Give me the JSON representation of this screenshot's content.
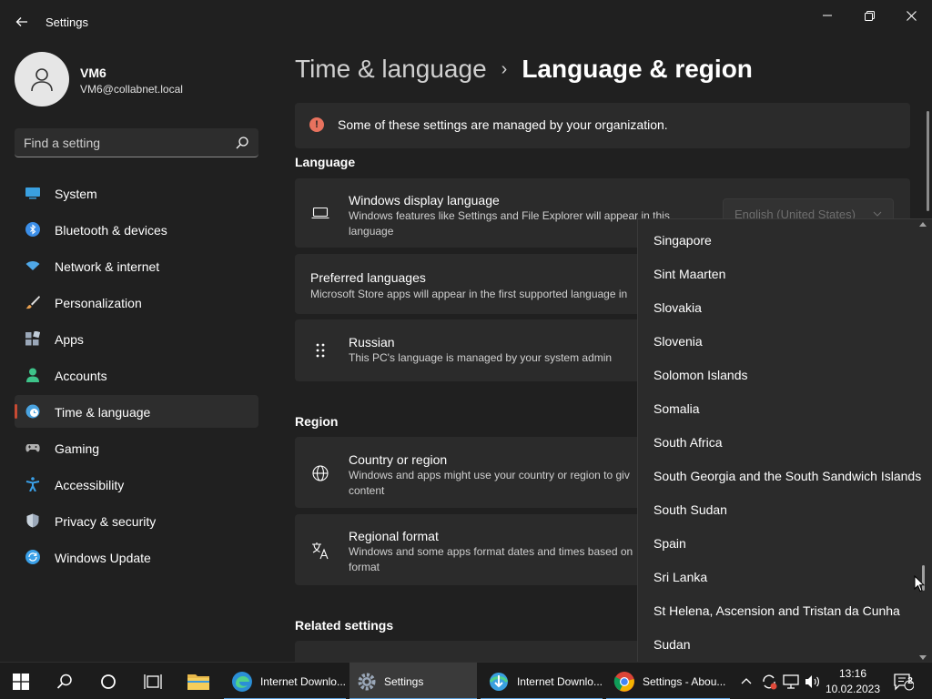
{
  "window": {
    "title": "Settings"
  },
  "user": {
    "name": "VM6",
    "email": "VM6@collabnet.local"
  },
  "search": {
    "placeholder": "Find a setting"
  },
  "sidebar": {
    "items": [
      {
        "label": "System",
        "icon": "system-icon",
        "color": "#3aa0e0"
      },
      {
        "label": "Bluetooth & devices",
        "icon": "bluetooth-icon",
        "color": "#3b8ee8"
      },
      {
        "label": "Network & internet",
        "icon": "wifi-icon",
        "color": "#4fa8e8"
      },
      {
        "label": "Personalization",
        "icon": "brush-icon",
        "color": "#e8a050"
      },
      {
        "label": "Apps",
        "icon": "apps-icon",
        "color": "#9aa7b8"
      },
      {
        "label": "Accounts",
        "icon": "person-icon",
        "color": "#3ec48a"
      },
      {
        "label": "Time & language",
        "icon": "clock-globe-icon",
        "color": "#4aa3e0",
        "active": true
      },
      {
        "label": "Gaming",
        "icon": "controller-icon",
        "color": "#b0b0b0"
      },
      {
        "label": "Accessibility",
        "icon": "accessibility-icon",
        "color": "#3aa0e8"
      },
      {
        "label": "Privacy & security",
        "icon": "shield-icon",
        "color": "#9aa7b8"
      },
      {
        "label": "Windows Update",
        "icon": "update-icon",
        "color": "#3aa0e8"
      }
    ]
  },
  "breadcrumb": {
    "parent": "Time & language",
    "separator": "›",
    "current": "Language & region"
  },
  "info_bar": {
    "text": "Some of these settings are managed by your organization."
  },
  "language": {
    "title": "Language",
    "display_language": {
      "title": "Windows display language",
      "subtitle_line1": "Windows features like Settings and File Explorer will appear in this",
      "subtitle_line2": "language",
      "selected": "English (United States)"
    },
    "preferred": {
      "title": "Preferred languages",
      "subtitle": "Microsoft Store apps will appear in the first supported language in"
    },
    "russian": {
      "title": "Russian",
      "subtitle": "This PC's language is managed by your system admin"
    }
  },
  "region": {
    "title": "Region",
    "country": {
      "title": "Country or region",
      "subtitle_line1": "Windows and apps might use your country or region to giv",
      "subtitle_line2": "content"
    },
    "format": {
      "title": "Regional format",
      "subtitle_line1": "Windows and some apps format dates and times based on",
      "subtitle_line2": "format"
    }
  },
  "related": {
    "title": "Related settings"
  },
  "dropdown": {
    "items": [
      "Singapore",
      "Sint Maarten",
      "Slovakia",
      "Slovenia",
      "Solomon Islands",
      "Somalia",
      "South Africa",
      "South Georgia and the South Sandwich Islands",
      "South Sudan",
      "Spain",
      "Sri Lanka",
      "St Helena, Ascension and Tristan da Cunha",
      "Sudan"
    ]
  },
  "taskbar": {
    "apps": [
      {
        "label": "Internet Downlo...",
        "icon": "edge-icon"
      },
      {
        "label": "Settings",
        "icon": "settings-gear-icon",
        "active": true
      },
      {
        "label": "Internet Downlo...",
        "icon": "idm-icon"
      },
      {
        "label": "Settings - Abou...",
        "icon": "chrome-icon"
      }
    ],
    "time": "13:16",
    "date": "10.02.2023",
    "notification_count": "2"
  }
}
